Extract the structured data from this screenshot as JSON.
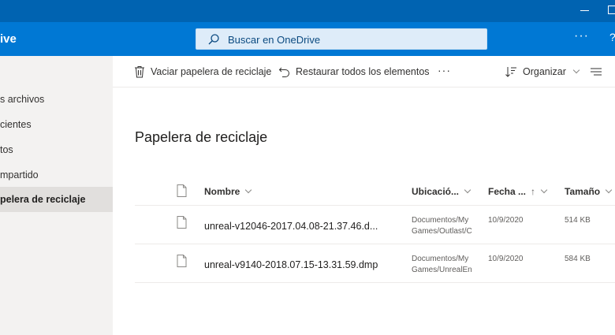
{
  "app": {
    "brand": "ive",
    "search_placeholder": "Buscar en OneDrive",
    "more_label": "···",
    "help_label": "?"
  },
  "nav": {
    "items": [
      {
        "label": "s archivos"
      },
      {
        "label": "cientes"
      },
      {
        "label": "tos"
      },
      {
        "label": "mpartido"
      },
      {
        "label": "pelera de reciclaje",
        "selected": true
      }
    ]
  },
  "toolbar": {
    "empty_label": "Vaciar papelera de reciclaje",
    "restore_label": "Restaurar todos los elementos",
    "more_label": "···",
    "organize_label": "Organizar"
  },
  "main": {
    "title": "Papelera de reciclaje",
    "columns": {
      "name": "Nombre",
      "location": "Ubicació...",
      "date": "Fecha ...",
      "date_sort": "↑",
      "size": "Tamaño"
    },
    "rows": [
      {
        "name": "unreal-v12046-2017.04.08-21.37.46.d...",
        "location_line1": "Documentos/My",
        "location_line2": "Games/Outlast/C",
        "date": "10/9/2020",
        "size": "514 KB"
      },
      {
        "name": "unreal-v9140-2018.07.15-13.31.59.dmp",
        "location_line1": "Documentos/My",
        "location_line2": "Games/UnrealEn",
        "date": "10/9/2020",
        "size": "584 KB"
      }
    ]
  },
  "colors": {
    "titlebar": "#0063b1",
    "suite_header": "#0078d4",
    "search_box": "#deecf9",
    "nav_background": "#f3f2f1",
    "nav_selected": "#e1dfdd"
  },
  "icons": {
    "search": "search-icon",
    "empty": "trash-icon",
    "restore": "undo-icon",
    "organize": "sort-icon",
    "view": "view-options-icon",
    "file": "file-icon"
  }
}
